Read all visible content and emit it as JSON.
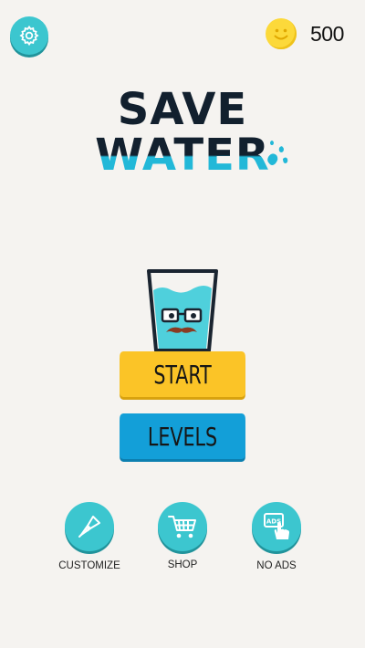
{
  "header": {
    "settings_icon": "gear-icon",
    "coin_icon": "smiley-coin-icon",
    "coins": "500"
  },
  "logo": {
    "line1": "SAVE",
    "line2": "WATER"
  },
  "mascot": {
    "icon": "glass-with-mustache-icon"
  },
  "menu": {
    "start_label": "START",
    "levels_label": "LEVELS"
  },
  "bottom": {
    "customize_label": "CUSTOMIZE",
    "customize_icon": "pen-nib-icon",
    "shop_label": "SHOP",
    "shop_icon": "shopping-cart-icon",
    "noads_label": "NO ADS",
    "noads_icon": "ads-tap-icon"
  },
  "colors": {
    "background": "#f5f3f0",
    "teal": "#3cc6cf",
    "start_yellow": "#fbc427",
    "levels_blue": "#139fd8",
    "coin_yellow": "#fcd93a",
    "logo_dark": "#12202e",
    "logo_blue": "#22b8d8"
  }
}
